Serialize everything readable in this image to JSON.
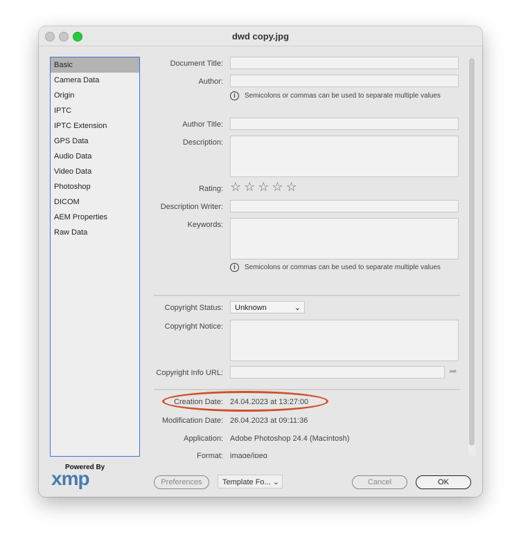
{
  "window": {
    "title": "dwd copy.jpg"
  },
  "sidebar": {
    "items": [
      "Basic",
      "Camera Data",
      "Origin",
      "IPTC",
      "IPTC Extension",
      "GPS Data",
      "Audio Data",
      "Video Data",
      "Photoshop",
      "DICOM",
      "AEM Properties",
      "Raw Data"
    ],
    "selected": "Basic"
  },
  "form": {
    "document_title": "Document Title:",
    "author": "Author:",
    "hint": "Semicolons or commas can be used to separate multiple values",
    "author_title": "Author Title:",
    "description": "Description:",
    "rating": "Rating:",
    "rating_value": 0,
    "description_writer": "Description Writer:",
    "keywords": "Keywords:",
    "copyright_status": "Copyright Status:",
    "copyright_status_value": "Unknown",
    "copyright_notice": "Copyright Notice:",
    "copyright_url": "Copyright Info URL:",
    "creation_date": "Creation Date:",
    "creation_date_value": "24.04.2023 at 13:27:00",
    "modification_date": "Modification Date:",
    "modification_date_value": "26.04.2023 at 09:11:36",
    "application": "Application:",
    "application_value": "Adobe Photoshop 24.4 (Macintosh)",
    "format": "Format:",
    "format_value": "image/jpeg"
  },
  "footer": {
    "powered_by": "Powered By",
    "logo": "xmp",
    "preferences": "Preferences",
    "template": "Template Fo...",
    "cancel": "Cancel",
    "ok": "OK"
  },
  "colors": {
    "highlight": "#d0502a",
    "selection_border": "#4a6fd6"
  }
}
